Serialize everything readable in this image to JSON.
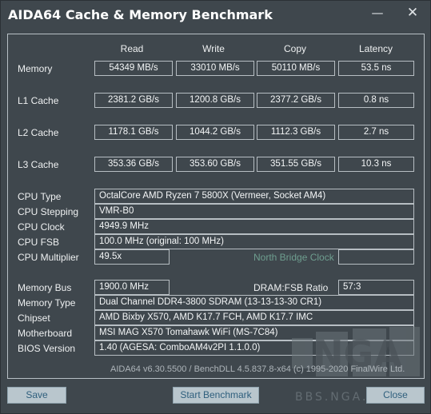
{
  "window": {
    "title": "AIDA64 Cache & Memory Benchmark",
    "minimize_glyph": "—",
    "close_glyph": "✕"
  },
  "columns": {
    "read": "Read",
    "write": "Write",
    "copy": "Copy",
    "latency": "Latency"
  },
  "results": [
    {
      "label": "Memory",
      "read": "54349 MB/s",
      "write": "33010 MB/s",
      "copy": "50110 MB/s",
      "latency": "53.5 ns"
    },
    {
      "label": "L1 Cache",
      "read": "2381.2 GB/s",
      "write": "1200.8 GB/s",
      "copy": "2377.2 GB/s",
      "latency": "0.8 ns"
    },
    {
      "label": "L2 Cache",
      "read": "1178.1 GB/s",
      "write": "1044.2 GB/s",
      "copy": "1112.3 GB/s",
      "latency": "2.7 ns"
    },
    {
      "label": "L3 Cache",
      "read": "353.36 GB/s",
      "write": "353.60 GB/s",
      "copy": "351.55 GB/s",
      "latency": "10.3 ns"
    }
  ],
  "cpu": {
    "type_label": "CPU Type",
    "type_value": "OctalCore AMD Ryzen 7 5800X  (Vermeer, Socket AM4)",
    "stepping_label": "CPU Stepping",
    "stepping_value": "VMR-B0",
    "clock_label": "CPU Clock",
    "clock_value": "4949.9 MHz",
    "fsb_label": "CPU FSB",
    "fsb_value": "100.0 MHz  (original: 100 MHz)",
    "multiplier_label": "CPU Multiplier",
    "multiplier_value": "49.5x",
    "north_bridge_label": "North Bridge Clock",
    "north_bridge_value": ""
  },
  "memory": {
    "bus_label": "Memory Bus",
    "bus_value": "1900.0 MHz",
    "dram_ratio_label": "DRAM:FSB Ratio",
    "dram_ratio_value": "57:3",
    "type_label": "Memory Type",
    "type_value": "Dual Channel DDR4-3800 SDRAM  (13-13-13-30 CR1)",
    "chipset_label": "Chipset",
    "chipset_value": "AMD Bixby X570, AMD K17.7 FCH, AMD K17.7 IMC",
    "motherboard_label": "Motherboard",
    "motherboard_value": "MSI MAG X570 Tomahawk WiFi (MS-7C84)",
    "bios_label": "BIOS Version",
    "bios_value": "1.40  (AGESA: ComboAM4v2PI 1.1.0.0)"
  },
  "footer": {
    "version": "AIDA64 v6.30.5500 / BenchDLL 4.5.837.8-x64  (c) 1995-2020 FinalWire Ltd."
  },
  "buttons": {
    "save": "Save",
    "start": "Start Benchmark",
    "close": "Close"
  },
  "watermark": {
    "logo_text": "NGA",
    "site_text": "BBS.NGA.CN"
  },
  "colors": {
    "background": "#3f474d",
    "border": "#b7bec3",
    "button_bg": "#b9c6cd",
    "button_text": "#2f5f7d",
    "disabled_label": "#6e9e8f"
  }
}
